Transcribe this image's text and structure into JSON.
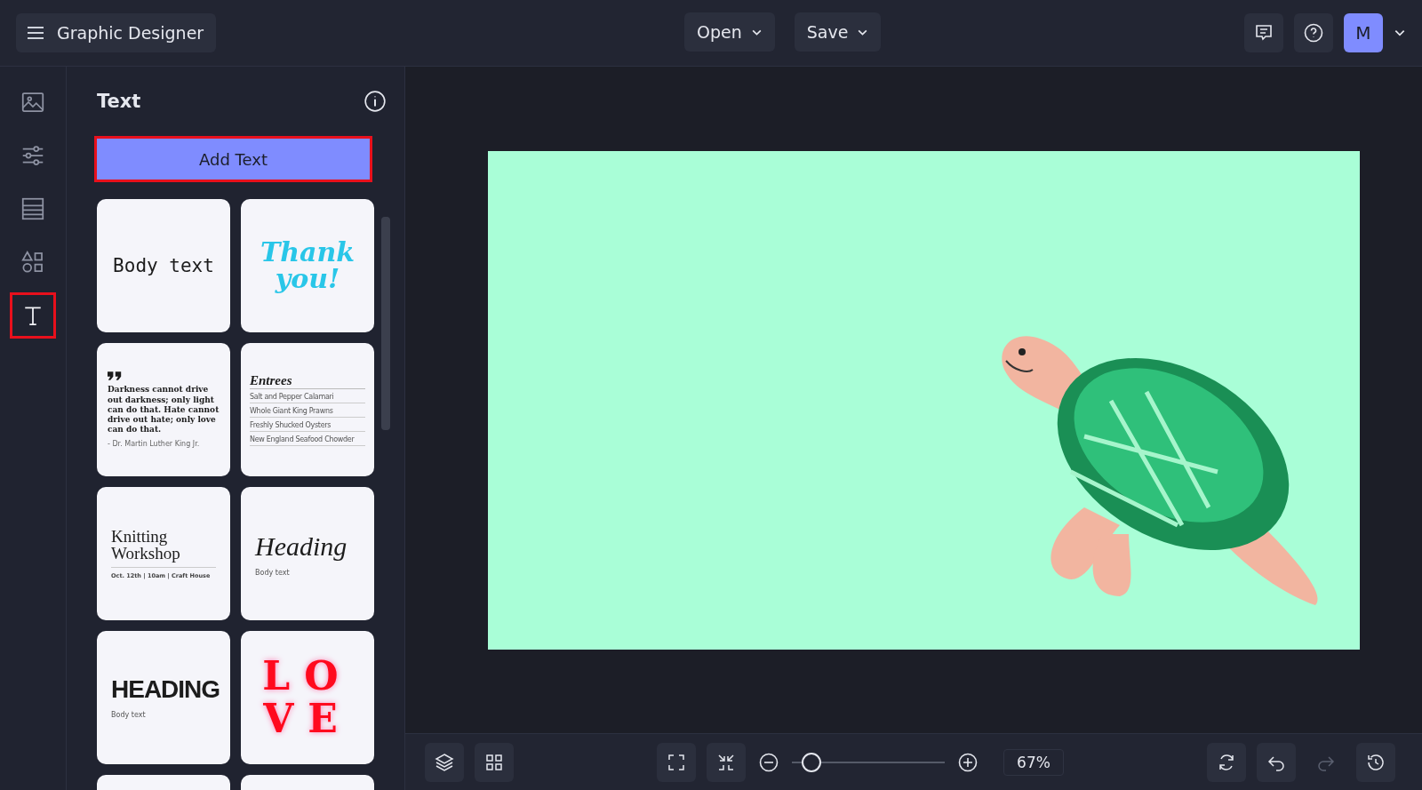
{
  "app": {
    "title": "Graphic Designer"
  },
  "top_menus": [
    {
      "label": "Open"
    },
    {
      "label": "Save"
    }
  ],
  "user": {
    "initial": "M"
  },
  "rail": [
    {
      "selected": false,
      "highlighted": false
    },
    {
      "selected": false,
      "highlighted": false
    },
    {
      "selected": false,
      "highlighted": false
    },
    {
      "selected": false,
      "highlighted": false
    },
    {
      "selected": true,
      "highlighted": true
    }
  ],
  "panel": {
    "title": "Text",
    "add_button": {
      "label": "Add Text",
      "highlighted": true
    },
    "templates": [
      {
        "kind": "mono",
        "lines": [
          "Body text"
        ]
      },
      {
        "kind": "script",
        "lines": [
          "Thank you!"
        ]
      },
      {
        "kind": "quote",
        "lines": [
          "Darkness cannot drive out darkness; only light can do that. Hate cannot drive out hate; only love can do that.",
          "- Dr. Martin Luther King Jr."
        ]
      },
      {
        "kind": "menu",
        "lines": [
          "Entrees",
          "Salt and Pepper Calamari",
          "Whole Giant King Prawns",
          "Freshly Shucked Oysters",
          "New England Seafood Chowder"
        ]
      },
      {
        "kind": "event",
        "lines": [
          "Knitting Workshop",
          "Oct. 12th | 10am | Craft House"
        ]
      },
      {
        "kind": "cursive",
        "lines": [
          "Heading",
          "Body text"
        ]
      },
      {
        "kind": "bold",
        "lines": [
          "HEADING",
          "Body text"
        ]
      },
      {
        "kind": "love",
        "lines": [
          "LO",
          "VE"
        ]
      },
      {
        "kind": "blank"
      },
      {
        "kind": "blank"
      }
    ]
  },
  "zoom": {
    "level": 0.13,
    "reading": "67%"
  },
  "redo": {
    "disabled": true
  }
}
